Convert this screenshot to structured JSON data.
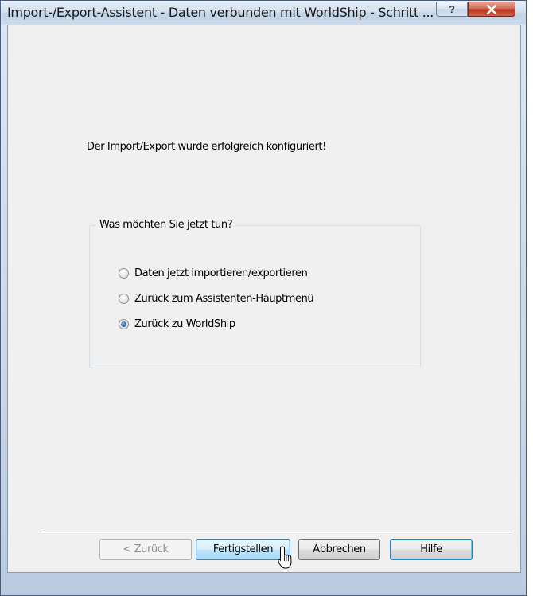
{
  "window": {
    "title": "Import-/Export-Assistent - Daten verbunden mit WorldShip - Schritt ...",
    "help_label": "?",
    "close_label": "✕"
  },
  "content": {
    "message": "Der Import/Export wurde erfolgreich konfiguriert!",
    "group": {
      "legend": "Was möchten Sie jetzt tun?",
      "options": [
        {
          "label": "Daten jetzt importieren/exportieren",
          "checked": false
        },
        {
          "label": "Zurück zum Assistenten-Hauptmenü",
          "checked": false
        },
        {
          "label": "Zurück zu WorldShip",
          "checked": true
        }
      ]
    }
  },
  "buttons": {
    "back": "< Zurück",
    "finish": "Fertigstellen",
    "cancel": "Abbrechen",
    "help": "Hilfe"
  },
  "colors": {
    "window_frame": "#c9d8e8",
    "client_bg": "#f0f0f0",
    "close_button": "#c4442c",
    "radio_selected": "#1d5fa5"
  },
  "icons": {
    "help": "question-mark-icon",
    "close": "close-icon",
    "pointer": "mouse-pointer-icon"
  }
}
